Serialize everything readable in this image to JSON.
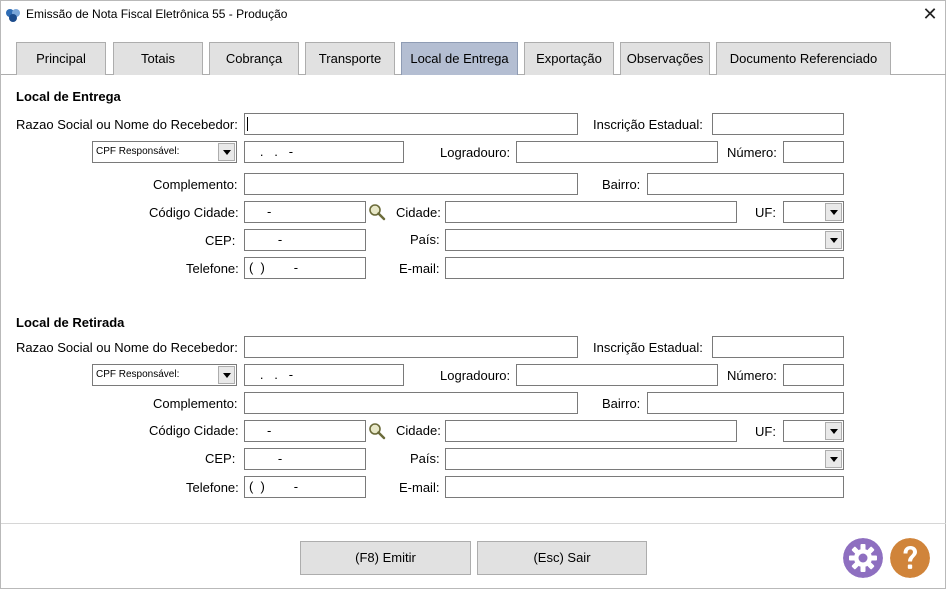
{
  "window": {
    "title": "Emissão de Nota Fiscal Eletrônica 55 - Produção",
    "close_label": "✕"
  },
  "tabs": [
    {
      "label": "Principal"
    },
    {
      "label": "Totais"
    },
    {
      "label": "Cobrança"
    },
    {
      "label": "Transporte"
    },
    {
      "label": "Local de Entrega"
    },
    {
      "label": "Exportação"
    },
    {
      "label": "Observações"
    },
    {
      "label": "Documento Referenciado"
    }
  ],
  "active_tab": "Local de Entrega",
  "entrega": {
    "title": "Local de Entrega",
    "razao_label": "Razao Social ou Nome do Recebedor:",
    "razao_value": "",
    "ie_label": "Inscrição Estadual:",
    "ie_value": "",
    "doc_type": "CPF Responsável:",
    "doc_value": "   .   .   -",
    "logradouro_label": "Logradouro:",
    "logradouro_value": "",
    "numero_label": "Número:",
    "numero_value": "",
    "complemento_label": "Complemento:",
    "complemento_value": "",
    "bairro_label": "Bairro:",
    "bairro_value": "",
    "codcidade_label": "Código Cidade:",
    "codcidade_value": "     -",
    "cidade_label": "Cidade:",
    "cidade_value": "",
    "uf_label": "UF:",
    "uf_value": "",
    "cep_label": "CEP:",
    "cep_value": "        -",
    "pais_label": "País:",
    "pais_value": "",
    "telefone_label": "Telefone:",
    "telefone_value": "(  )        -",
    "email_label": "E-mail:",
    "email_value": ""
  },
  "retirada": {
    "title": "Local de Retirada",
    "razao_label": "Razao Social ou Nome do Recebedor:",
    "razao_value": "",
    "ie_label": "Inscrição Estadual:",
    "ie_value": "",
    "doc_type": "CPF Responsável:",
    "doc_value": "   .   .   -",
    "logradouro_label": "Logradouro:",
    "logradouro_value": "",
    "numero_label": "Número:",
    "numero_value": "",
    "complemento_label": "Complemento:",
    "complemento_value": "",
    "bairro_label": "Bairro:",
    "bairro_value": "",
    "codcidade_label": "Código Cidade:",
    "codcidade_value": "     -",
    "cidade_label": "Cidade:",
    "cidade_value": "",
    "uf_label": "UF:",
    "uf_value": "",
    "cep_label": "CEP:",
    "cep_value": "        -",
    "pais_label": "País:",
    "pais_value": "",
    "telefone_label": "Telefone:",
    "telefone_value": "(  )        -",
    "email_label": "E-mail:",
    "email_value": ""
  },
  "footer": {
    "emitir_label": "(F8) Emitir",
    "sair_label": "(Esc) Sair"
  },
  "icons": {
    "settings": "gear-icon",
    "help": "question-icon",
    "search": "search-icon"
  },
  "colors": {
    "active_tab": "#b4bed2",
    "settings": "#8e6fc0",
    "help": "#d0843a"
  }
}
